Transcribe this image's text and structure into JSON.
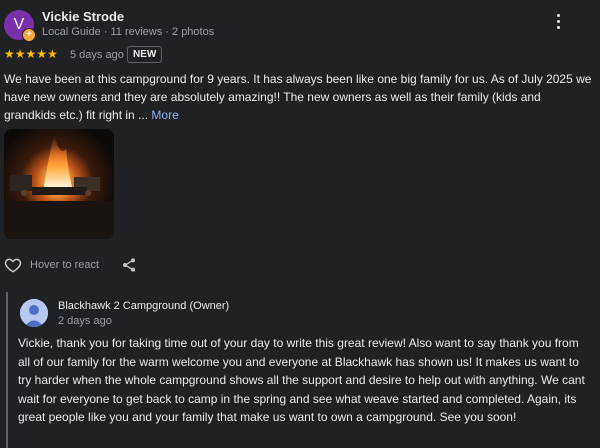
{
  "reviewer": {
    "avatar_letter": "V",
    "avatar_color": "#7b2fa8",
    "name": "Vickie Strode",
    "meta": "Local Guide · 11 reviews · 2 photos"
  },
  "review": {
    "rating": 5,
    "stars": "★★★★★",
    "star_color": "#fbbc04",
    "date": "5 days ago",
    "badge": "NEW",
    "text": "We have been at this campground for 9 years. It has always been like one big family for us. As of July 2025 we have new owners and they are absolutely amazing!! The new owners as well as their family (kids and grandkids etc.) fit right in ... ",
    "more_label": "More",
    "photo_icon": "campfire-photo"
  },
  "actions": {
    "like_icon": "heart-outline-icon",
    "hover_label": "Hover to react",
    "share_icon": "share-icon"
  },
  "owner_reply": {
    "name": "Blackhawk 2 Campground (Owner)",
    "date": "2 days ago",
    "text": "Vickie, thank you for taking time out of your day to write this great review! Also want to say thank you from all of our family for the warm welcome you and everyone at Blackhawk has shown us! It makes us want to try harder when the whole campground shows all the support and desire to help out with anything. We cant wait for everyone to get back to camp in the spring and see what weave started and completed. Again, its great people like you and your family that make us want to own a campground. See you soon!"
  },
  "colors": {
    "background": "#202124",
    "link": "#8ab4f8",
    "muted_text": "#9aa0a6"
  }
}
